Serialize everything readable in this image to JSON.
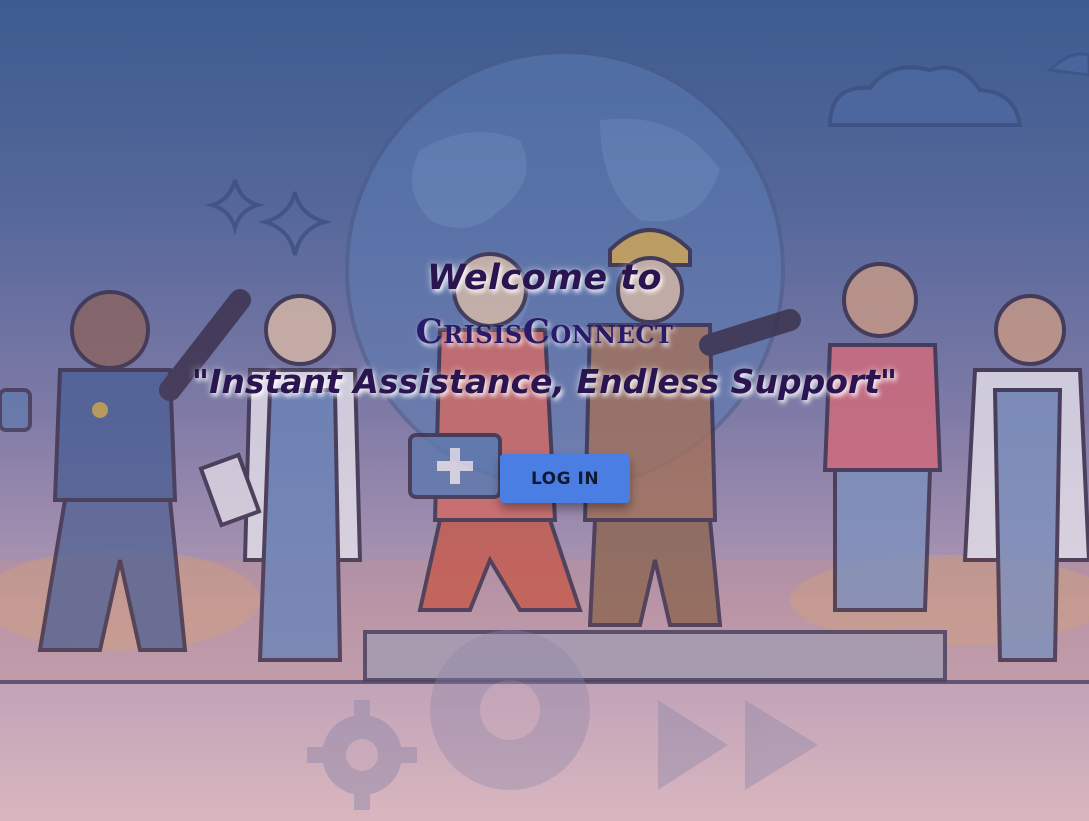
{
  "hero": {
    "welcome": "Welcome to",
    "brand": "CrisisConnect",
    "tagline": "\"Instant Assistance, Endless Support\""
  },
  "actions": {
    "login_label": "LOG IN"
  },
  "illustration": {
    "description_icons": [
      "globe-icon",
      "cloud-icon",
      "sparkle-icon",
      "gear-icon",
      "play-icon"
    ],
    "colors": {
      "sky_top": "#3c5b8f",
      "sky_bottom": "#d9b6bf",
      "button": "#4a7ee3",
      "heading": "#2a1550"
    }
  }
}
